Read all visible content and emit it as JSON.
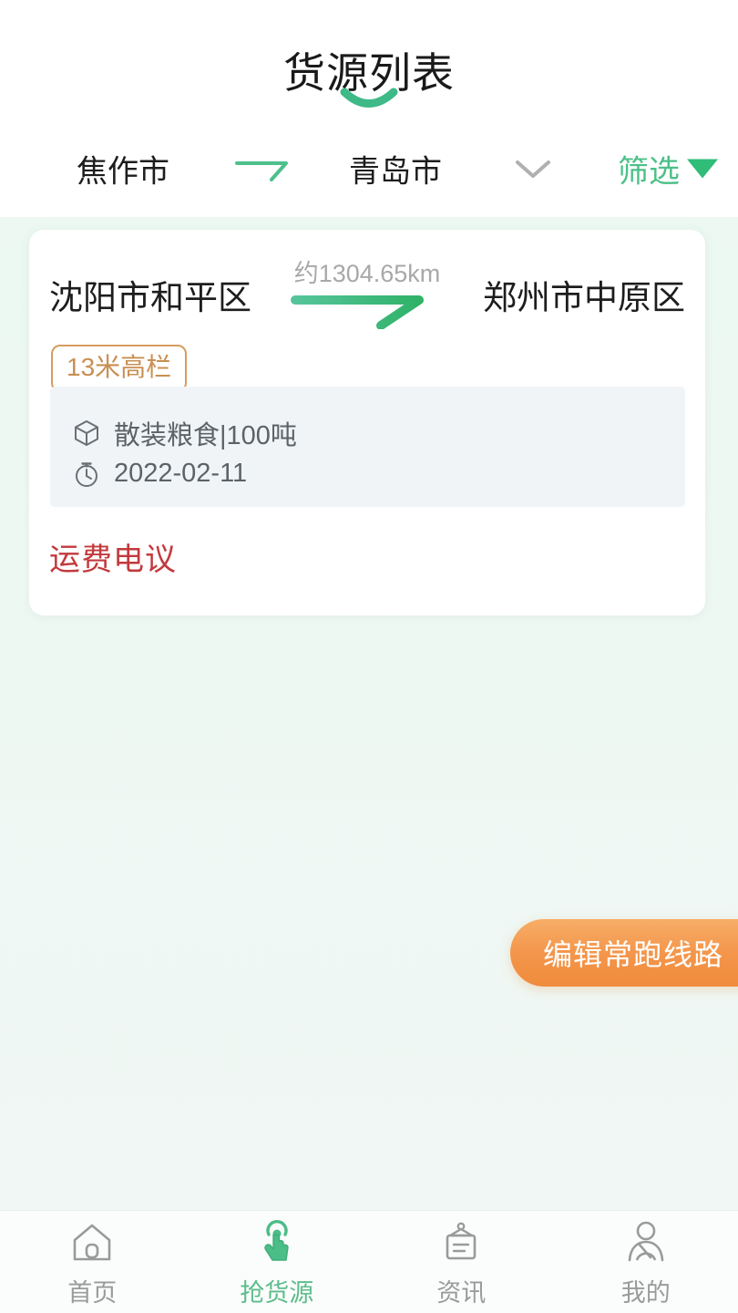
{
  "header": {
    "title": "货源列表",
    "underline_color": "#3fb987"
  },
  "filter": {
    "origin_city": "焦作市",
    "dest_city": "青岛市",
    "arrow_icon": "route-arrow-icon",
    "chevron_icon": "chevron-down-icon",
    "filter_label": "筛选",
    "filter_triangle_icon": "triangle-down-icon",
    "accent_color": "#4cc088"
  },
  "card": {
    "from_city": "沈阳市和平区",
    "to_city": "郑州市中原区",
    "distance": "约1304.65km",
    "route_arrow_icon": "route-arrow-icon",
    "tag": "13米高栏",
    "tag_color": "#c98f52",
    "tag_border_color": "#d79c5e",
    "cargo_icon": "box-icon",
    "cargo": "散装粮食|100吨",
    "time_icon": "stopwatch-icon",
    "date": "2022-02-11",
    "price": "运费电议",
    "price_color": "#c2393c"
  },
  "fab": {
    "label": "编辑常跑线路",
    "color_start": "#f7ae68",
    "color_end": "#f08c3c"
  },
  "tabbar": {
    "active_color": "#5dbd8c",
    "inactive_color": "#9a9a9a",
    "items": [
      {
        "label": "首页",
        "icon": "home-icon",
        "active": false
      },
      {
        "label": "抢货源",
        "icon": "tap-hand-icon",
        "active": true
      },
      {
        "label": "资讯",
        "icon": "clipboard-icon",
        "active": false
      },
      {
        "label": "我的",
        "icon": "driver-icon",
        "active": false
      }
    ]
  }
}
